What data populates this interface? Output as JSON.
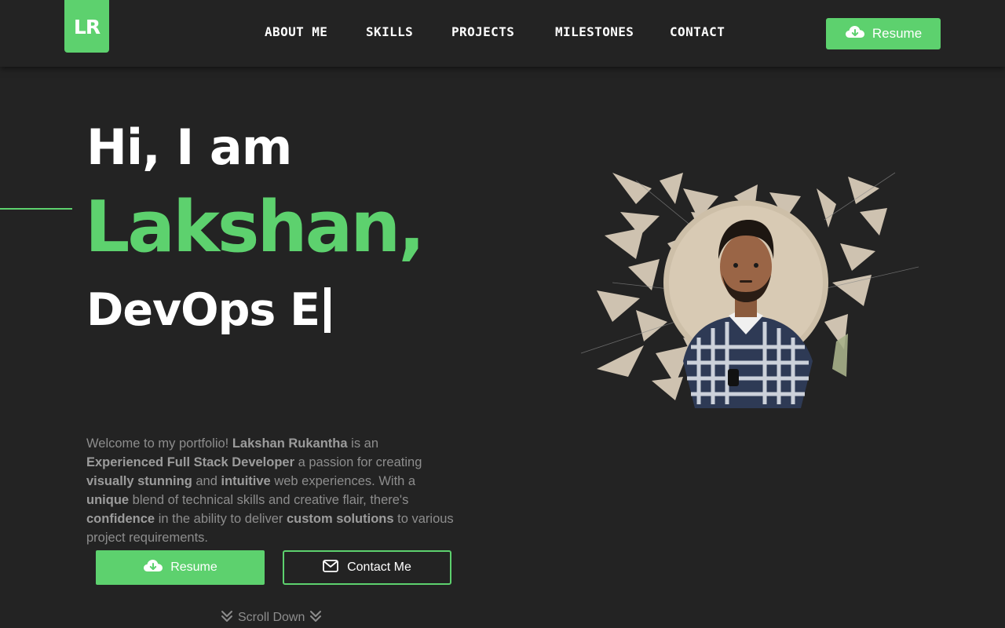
{
  "logo": {
    "text": "LR"
  },
  "nav": {
    "items": [
      {
        "label": "About Me"
      },
      {
        "label": "Skills"
      },
      {
        "label": "Projects"
      },
      {
        "label": "Milestones"
      },
      {
        "label": "Contact"
      }
    ],
    "resume_label": "Resume"
  },
  "hero": {
    "greeting": "Hi, I am",
    "name": "Lakshan,",
    "role_typed": "DevOps E",
    "intro": [
      {
        "t": "Welcome to my portfolio! ",
        "b": false
      },
      {
        "t": "Lakshan Rukantha",
        "b": true
      },
      {
        "t": " is an ",
        "b": false
      },
      {
        "t": "Experienced Full Stack Developer",
        "b": true
      },
      {
        "t": " a passion for creating ",
        "b": false
      },
      {
        "t": "visually stunning",
        "b": true
      },
      {
        "t": " and ",
        "b": false
      },
      {
        "t": "intuitive",
        "b": true
      },
      {
        "t": " web experiences. With a ",
        "b": false
      },
      {
        "t": "unique",
        "b": true
      },
      {
        "t": " blend of technical skills and creative flair, there's ",
        "b": false
      },
      {
        "t": "confidence",
        "b": true
      },
      {
        "t": " in the ability to deliver ",
        "b": false
      },
      {
        "t": "custom solutions",
        "b": true
      },
      {
        "t": " to various project requirements.",
        "b": false
      }
    ],
    "resume_button": "Resume",
    "contact_button": "Contact Me",
    "scroll_label": "Scroll Down"
  },
  "icons": {
    "download": "cloud-download-icon",
    "mail": "envelope-icon",
    "scroll": "double-chevron-down-icon"
  },
  "colors": {
    "accent": "#5dd16e",
    "background": "#232323",
    "muted_text": "#8d8d8d"
  }
}
